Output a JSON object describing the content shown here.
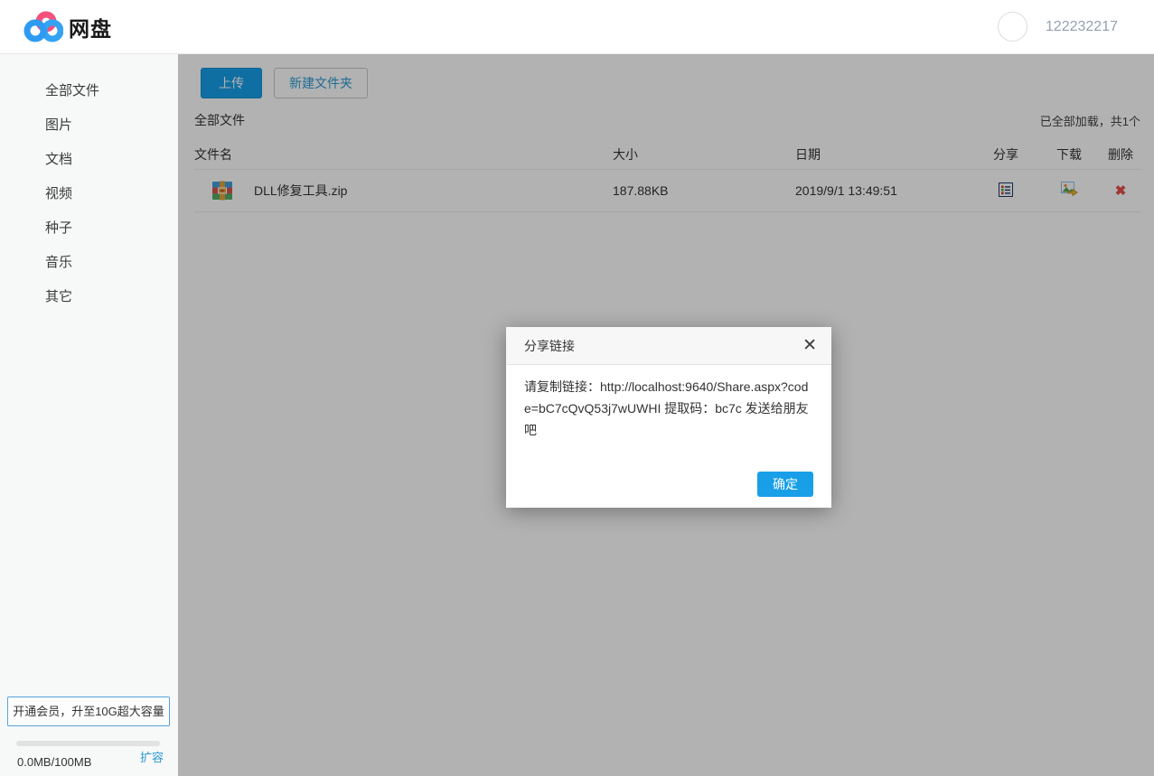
{
  "header": {
    "app_title": "网盘",
    "user_id": "122232217"
  },
  "sidebar": {
    "items": [
      "全部文件",
      "图片",
      "文档",
      "视频",
      "种子",
      "音乐",
      "其它"
    ],
    "member_button_label": "开通会员，升至10G超大容量",
    "quota": {
      "usage_text": "0.0MB/100MB",
      "expand_label": "扩容",
      "percent_used": 0
    }
  },
  "toolbar": {
    "upload_label": "上传",
    "new_folder_label": "新建文件夹"
  },
  "file_list": {
    "section_title": "全部文件",
    "load_status": "已全部加载，共1个",
    "columns": [
      "文件名",
      "大小",
      "日期",
      "分享",
      "下载",
      "删除"
    ],
    "rows": [
      {
        "name": "DLL修复工具.zip",
        "size": "187.88KB",
        "date": "2019/9/1 13:49:51"
      }
    ]
  },
  "dialog": {
    "title": "分享链接",
    "close_glyph": "✕",
    "body_text": "请复制链接：http://localhost:9640/Share.aspx?code=bC7cQvQ53j7wUWHI 提取码：bc7c 发送给朋友吧",
    "confirm_label": "确定"
  },
  "icons": {
    "delete_glyph": "✖"
  },
  "colors": {
    "accent_blue": "#189fe8",
    "link_blue": "#2b9ad3",
    "delete_red": "#e2504c",
    "user_id_gray": "#94a1b0"
  }
}
